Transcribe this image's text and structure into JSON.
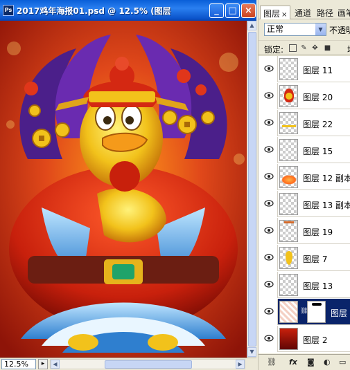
{
  "window": {
    "title": "2017鸡年海报01.psd @ 12.5% (图层",
    "app_icon": "Ps",
    "buttons": {
      "minimize": "_",
      "maximize": "□",
      "close": "×"
    }
  },
  "status": {
    "zoom": "12.5%"
  },
  "panel": {
    "tabs": [
      {
        "label": "图层",
        "close": "×"
      },
      {
        "label": "通道"
      },
      {
        "label": "路径"
      },
      {
        "label": "画笔"
      }
    ],
    "blend_mode": "正常",
    "opacity_label": "不透明",
    "lock_label": "锁定:",
    "fill_label": "填",
    "layers": [
      {
        "name": "图层 11",
        "visible": true,
        "thumb": "empty"
      },
      {
        "name": "图层 20",
        "visible": true,
        "thumb": "rooster"
      },
      {
        "name": "图层 22",
        "visible": true,
        "thumb": "yellow-strip"
      },
      {
        "name": "图层 15",
        "visible": true,
        "thumb": "empty"
      },
      {
        "name": "图层 12 副本",
        "visible": true,
        "thumb": "orange-glow"
      },
      {
        "name": "图层 13 副本",
        "visible": true,
        "thumb": "empty"
      },
      {
        "name": "图层 19",
        "visible": true,
        "thumb": "top-dots"
      },
      {
        "name": "图层 7",
        "visible": true,
        "thumb": "yellow-drop"
      },
      {
        "name": "图层 13",
        "visible": true,
        "thumb": "empty"
      },
      {
        "name": "图层",
        "visible": true,
        "thumb": "mask",
        "selected": true
      },
      {
        "name": "图层 2",
        "visible": true,
        "thumb": "red-gradient"
      }
    ]
  },
  "colors": {
    "selection": "#0a246a",
    "titlebar": "#0a5fd8",
    "canvas_red": "#c83010",
    "canvas_gold": "#f2c21b"
  }
}
